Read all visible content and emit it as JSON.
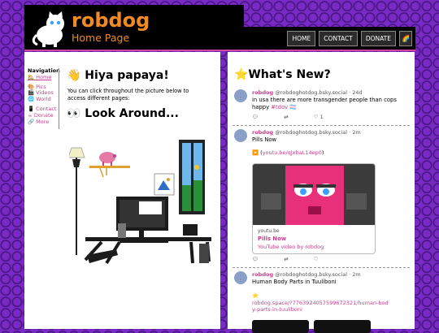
{
  "site": {
    "title": "robdog",
    "subtitle": "Home Page"
  },
  "nav_buttons": {
    "home": "HOME",
    "contact": "CONTACT",
    "donate": "DONATE",
    "rainbow": "🌈"
  },
  "sidebar": {
    "heading": "Navigation",
    "items": [
      {
        "label": "🏡 Home"
      },
      {
        "label": "🎨 Pics"
      },
      {
        "label": "🎬 Videos"
      },
      {
        "label": "🌐 World"
      },
      {
        "label": "📱 Contact"
      },
      {
        "label": "☕ Donate"
      },
      {
        "label": "🔗 More"
      }
    ]
  },
  "main": {
    "greeting": "👋 Hiya papaya!",
    "intro": "You can click throughout the picture below to access different pages:",
    "look_heading": "👀 Look Around..."
  },
  "feed": {
    "title": "⭐What's New?",
    "posts": [
      {
        "name": "robdog",
        "handle": "@robdoghotdog.bsky.social · 24d",
        "text": "in usa there are more transgender people than cops happy",
        "tag": "#tdov",
        "flag": "🏳️‍⚧️",
        "likes": "1"
      },
      {
        "name": "robdog",
        "handle": "@robdoghotdog.bsky.social · 2m",
        "text": "Pills Now",
        "link": "youtu.be/qJxbaL14ep0",
        "card_domain": "youtu.be",
        "card_title": "Pills Now",
        "card_desc": "YouTube video by robdog"
      },
      {
        "name": "robdog",
        "handle": "@robdoghotdog.bsky.social · 2m",
        "text": "Human Body Parts in Tuuliboni",
        "star": "⭐",
        "link": "robdog.space/?7763924057599672321/human-body-parts-in-tuuliboni"
      }
    ]
  },
  "colors": {
    "accent": "#c5418c",
    "title": "#f08a24",
    "header_bg": "#000000",
    "page_bg": "#7a2ac4"
  }
}
